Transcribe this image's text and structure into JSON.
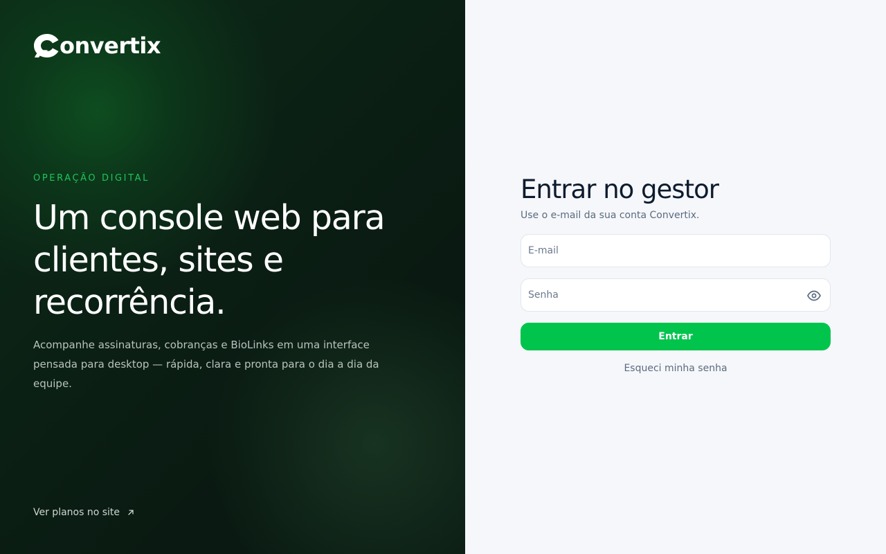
{
  "brand": {
    "name": "Convertix",
    "logo_text": "onvertix",
    "logo_icon": "convertix-c-mark"
  },
  "hero": {
    "eyebrow": "OPERAÇÃO DIGITAL",
    "headline": "Um console web para clientes, sites e recorrência.",
    "lead": "Acompanhe assinaturas, cobranças e BioLinks em uma interface pensada para desktop — rápida, clara e pronta para o dia a dia da equipe.",
    "plans_link": "Ver planos no site",
    "plans_icon": "arrow-up-right-icon"
  },
  "login": {
    "title": "Entrar no gestor",
    "subtitle": "Use o e-mail da sua conta Convertix.",
    "email_placeholder": "E-mail",
    "email_value": "",
    "password_placeholder": "Senha",
    "password_value": "",
    "toggle_icon": "eye-icon",
    "submit_label": "Entrar",
    "forgot_label": "Esqueci minha senha"
  },
  "colors": {
    "accent": "#00c44c",
    "eyebrow": "#1fc45a",
    "title": "#0d1b2e",
    "muted": "#5b6b7f",
    "panel_dark": "#0b1f14",
    "panel_light": "#f5f7fa"
  }
}
